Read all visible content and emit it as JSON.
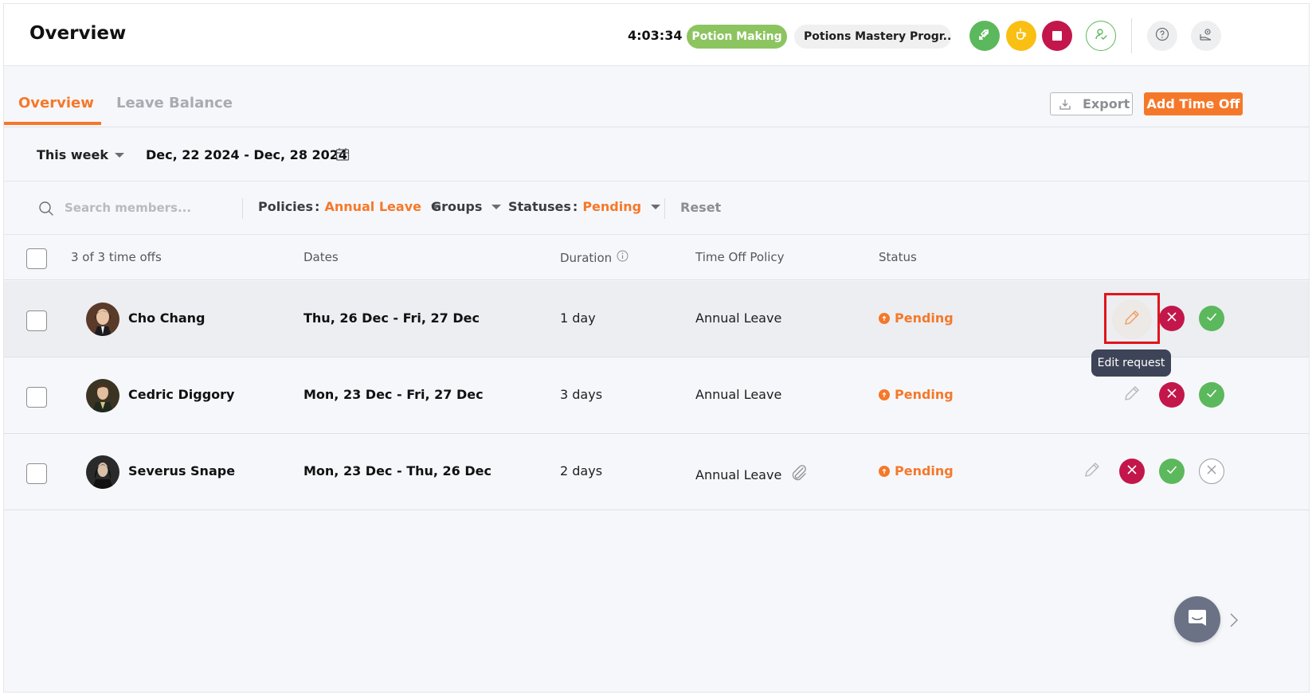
{
  "header": {
    "title": "Overview",
    "timer": "4:03:34",
    "project_pill": "Potion Making",
    "task_pill": "Potions Mastery Progr...",
    "icons": {
      "switch": "switch-task-icon",
      "break": "coffee-break-icon",
      "stop": "stop-icon",
      "presence": "user-presence-icon",
      "help": "help-icon",
      "settings": "settings-icon"
    }
  },
  "tabs": {
    "items": [
      {
        "label": "Overview",
        "active": true
      },
      {
        "label": "Leave Balance",
        "active": false
      }
    ],
    "export_label": "Export",
    "add_label": "Add Time Off"
  },
  "date_filter": {
    "range_option": "This week",
    "date_range": "Dec, 22 2024 - Dec, 28 2024"
  },
  "filters": {
    "search_placeholder": "Search members...",
    "policies_label": "Policies",
    "policies_value": "Annual Leave",
    "groups_label": "Groups",
    "statuses_label": "Statuses",
    "statuses_value": "Pending",
    "reset_label": "Reset"
  },
  "table": {
    "count_label": "3 of 3 time offs",
    "columns": [
      "Dates",
      "Duration",
      "Time Off Policy",
      "Status"
    ],
    "rows": [
      {
        "name": "Cho Chang",
        "dates": "Thu, 26 Dec - Fri, 27 Dec",
        "duration": "1 day",
        "policy": "Annual Leave",
        "attachment": false,
        "status": "Pending"
      },
      {
        "name": "Cedric Diggory",
        "dates": "Mon, 23 Dec - Fri, 27 Dec",
        "duration": "3 days",
        "policy": "Annual Leave",
        "attachment": false,
        "status": "Pending"
      },
      {
        "name": "Severus Snape",
        "dates": "Mon, 23 Dec - Thu, 26 Dec",
        "duration": "2 days",
        "policy": "Annual Leave",
        "attachment": true,
        "status": "Pending"
      }
    ]
  },
  "tooltip": "Edit request",
  "colors": {
    "accent": "#f5782a",
    "approve": "#5cb85c",
    "reject": "#c3174b",
    "break": "#f9bf13",
    "project_pill": "#8cc460"
  }
}
